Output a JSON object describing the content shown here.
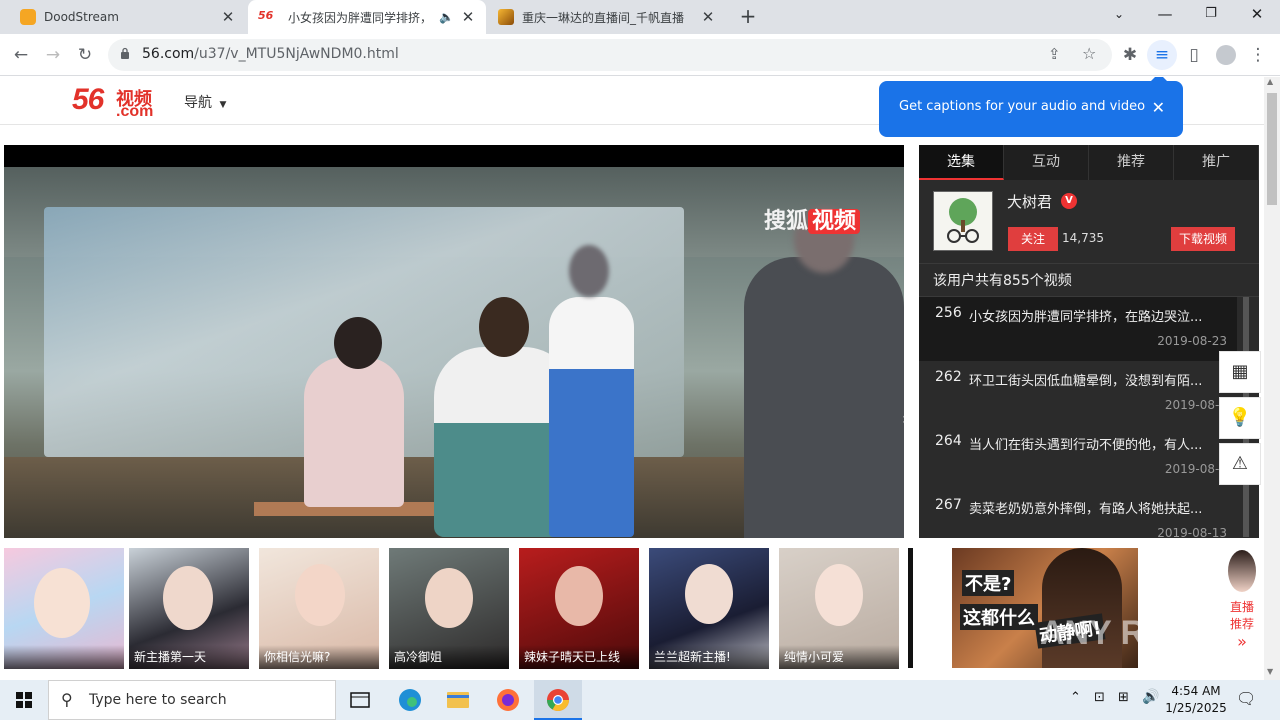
{
  "browser": {
    "tabs": [
      {
        "title": "DoodStream",
        "icon": "doodstream-favicon"
      },
      {
        "title": "小女孩因为胖遭同学排挤，",
        "icon": "56-favicon",
        "audio": true
      },
      {
        "title": "重庆一琳达的直播间_千帆直播",
        "icon": "qianfan-favicon"
      }
    ],
    "url_host": "56.com",
    "url_path": "/u37/v_MTU5NjAwNDM0.html"
  },
  "site": {
    "logo_num": "56",
    "logo_cn": "视频",
    "logo_com": ".com",
    "nav_label": "导航"
  },
  "caption_bubble": {
    "text": "Get captions for your audio and video"
  },
  "player": {
    "watermark_left": "搜狐",
    "watermark_right": "视频"
  },
  "panel": {
    "tabs": [
      "选集",
      "互动",
      "推荐",
      "推广"
    ],
    "uploader": "大树君",
    "verified_mark": "V",
    "follow_label": "关注",
    "followers": "14,735",
    "download_label": "下载视频",
    "video_count_text": "该用户共有855个视频",
    "videos": [
      {
        "ep": "256",
        "title": "小女孩因为胖遭同学排挤，在路边哭泣...",
        "date": "2019-08-23"
      },
      {
        "ep": "262",
        "title": "环卫工街头因低血糖晕倒，没想到有陌...",
        "date": "2019-08-2"
      },
      {
        "ep": "264",
        "title": "当人们在街头遇到行动不便的他，有人...",
        "date": "2019-08-1"
      },
      {
        "ep": "267",
        "title": "卖菜老奶奶意外摔倒，有路人将她扶起...",
        "date": "2019-08-13"
      }
    ]
  },
  "thumbs": [
    {
      "caption": ""
    },
    {
      "caption": "新主播第一天"
    },
    {
      "caption": "你相信光嘛?"
    },
    {
      "caption": "高冷御姐"
    },
    {
      "caption": "辣妹子晴天已上线"
    },
    {
      "caption": "兰兰超新主播!"
    },
    {
      "caption": "纯情小可爱"
    }
  ],
  "ad": {
    "line1": "不是?",
    "line2": "这都什么",
    "line3": "动静啊!"
  },
  "live_rec": {
    "line1": "直播",
    "line2": "推荐",
    "arrow": "»"
  },
  "anyrun_watermark": "ANY RUN",
  "taskbar": {
    "search_placeholder": "Type here to search",
    "time": "4:54 AM",
    "date": "1/25/2025"
  },
  "colors": {
    "brand_red": "#e2322a",
    "chrome_blue": "#1a73e8",
    "panel_dark": "#2b2b2b"
  }
}
